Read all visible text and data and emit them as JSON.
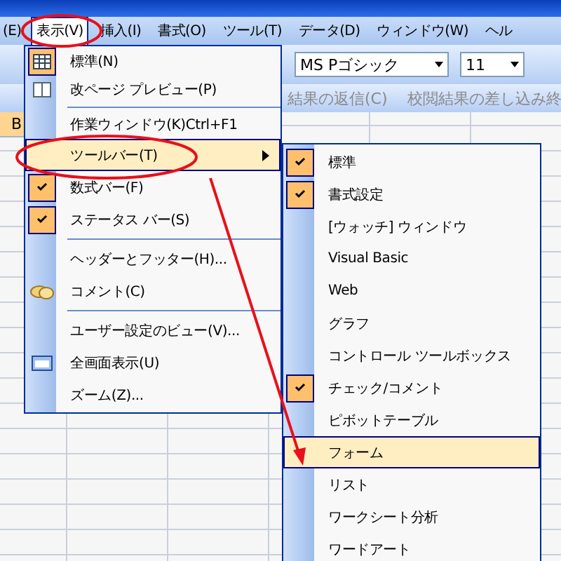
{
  "menu_bar": [
    {
      "label": "(E)",
      "open": false
    },
    {
      "label": "表示(V)",
      "open": true
    },
    {
      "label": "挿入(I)",
      "open": false
    },
    {
      "label": "書式(O)",
      "open": false
    },
    {
      "label": "ツール(T)",
      "open": false
    },
    {
      "label": "データ(D)",
      "open": false
    },
    {
      "label": "ウィンドウ(W)",
      "open": false
    },
    {
      "label": "ヘル",
      "open": false
    }
  ],
  "toolbar": {
    "font": "MS Pゴシック",
    "size": "11"
  },
  "review_toolbar": [
    "結果の返信(C)",
    "校閲結果の差し込み終"
  ],
  "sheet": {
    "column_header": "B"
  },
  "view_menu": [
    {
      "kind": "item",
      "label": "標準(N)",
      "checked": true,
      "selected": false
    },
    {
      "kind": "item",
      "label": "改ページ プレビュー(P)",
      "checked": false,
      "selected": false
    },
    {
      "kind": "separator"
    },
    {
      "kind": "item",
      "label": "作業ウィンドウ(K)",
      "shortcut": "Ctrl+F1",
      "checked": false,
      "selected": false
    },
    {
      "kind": "item",
      "label": "ツールバー(T)",
      "checked": false,
      "selected": true,
      "submenu": true
    },
    {
      "kind": "item",
      "label": "数式バー(F)",
      "checked": true,
      "selected": false
    },
    {
      "kind": "item",
      "label": "ステータス バー(S)",
      "checked": true,
      "selected": false
    },
    {
      "kind": "separator"
    },
    {
      "kind": "item",
      "label": "ヘッダーとフッター(H)...",
      "checked": false,
      "selected": false
    },
    {
      "kind": "item",
      "label": "コメント(C)",
      "checked": false,
      "selected": false
    },
    {
      "kind": "separator"
    },
    {
      "kind": "item",
      "label": "ユーザー設定のビュー(V)...",
      "checked": false,
      "selected": false
    },
    {
      "kind": "item",
      "label": "全画面表示(U)",
      "checked": false,
      "selected": false
    },
    {
      "kind": "item",
      "label": "ズーム(Z)...",
      "checked": false,
      "selected": false
    }
  ],
  "toolbars_submenu": [
    {
      "label": "標準",
      "checked": true,
      "selected": false
    },
    {
      "label": "書式設定",
      "checked": true,
      "selected": false
    },
    {
      "label": "[ウォッチ] ウィンドウ",
      "checked": false,
      "selected": false
    },
    {
      "label": "Visual Basic",
      "checked": false,
      "selected": false
    },
    {
      "label": "Web",
      "checked": false,
      "selected": false
    },
    {
      "label": "グラフ",
      "checked": false,
      "selected": false
    },
    {
      "label": "コントロール ツールボックス",
      "checked": false,
      "selected": false
    },
    {
      "label": "チェック/コメント",
      "checked": true,
      "selected": false
    },
    {
      "label": "ピボットテーブル",
      "checked": false,
      "selected": false
    },
    {
      "label": "フォーム",
      "checked": false,
      "selected": true
    },
    {
      "label": "リスト",
      "checked": false,
      "selected": false
    },
    {
      "label": "ワークシート分析",
      "checked": false,
      "selected": false
    },
    {
      "label": "ワードアート",
      "checked": false,
      "selected": false
    }
  ]
}
